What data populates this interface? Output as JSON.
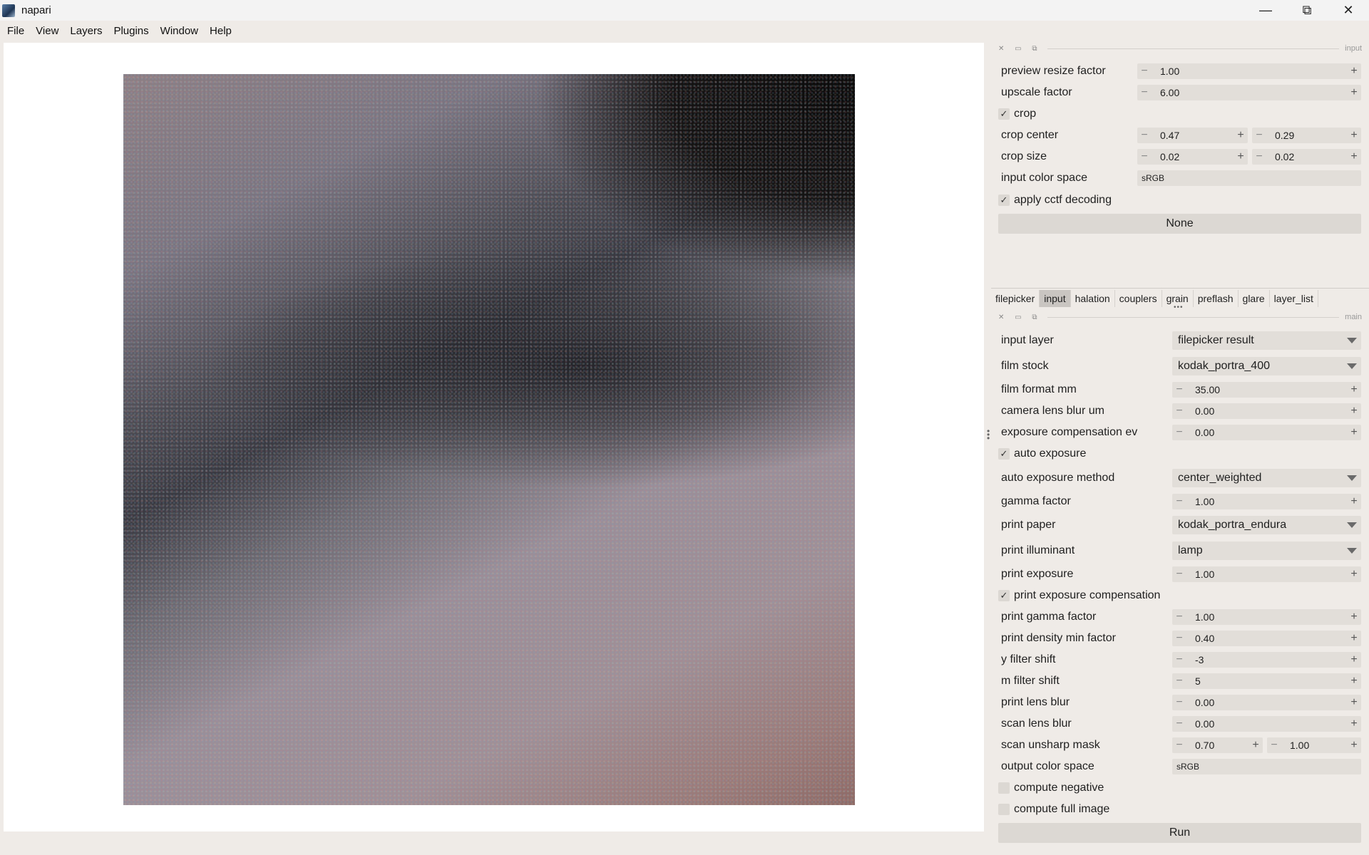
{
  "window": {
    "title": "napari",
    "min_icon": "minimize-icon",
    "max_icon": "restore-icon",
    "close_icon": "close-icon"
  },
  "menu": [
    "File",
    "View",
    "Layers",
    "Plugins",
    "Window",
    "Help"
  ],
  "input_panel": {
    "dock_name": "input",
    "preview_resize_factor": {
      "label": "preview resize factor",
      "value": "1.00"
    },
    "upscale_factor": {
      "label": "upscale factor",
      "value": "6.00"
    },
    "crop": {
      "label": "crop",
      "checked": true
    },
    "crop_center": {
      "label": "crop center",
      "x": "0.47",
      "y": "0.29"
    },
    "crop_size": {
      "label": "crop size",
      "x": "0.02",
      "y": "0.02"
    },
    "input_color_space": {
      "label": "input color space",
      "value": "sRGB"
    },
    "apply_cctf": {
      "label": "apply cctf decoding",
      "checked": true
    },
    "result_button": "None"
  },
  "tabs": [
    "filepicker",
    "input",
    "halation",
    "couplers",
    "grain",
    "preflash",
    "glare",
    "layer_list"
  ],
  "active_tab": "input",
  "main_panel": {
    "dock_name": "main",
    "input_layer": {
      "label": "input layer",
      "value": "filepicker result"
    },
    "film_stock": {
      "label": "film stock",
      "value": "kodak_portra_400"
    },
    "film_format_mm": {
      "label": "film format mm",
      "value": "35.00"
    },
    "camera_lens_blur": {
      "label": "camera lens blur um",
      "value": "0.00"
    },
    "exposure_comp": {
      "label": "exposure compensation ev",
      "value": "0.00"
    },
    "auto_exposure": {
      "label": "auto exposure",
      "checked": true
    },
    "auto_exposure_method": {
      "label": "auto exposure method",
      "value": "center_weighted"
    },
    "gamma_factor": {
      "label": "gamma factor",
      "value": "1.00"
    },
    "print_paper": {
      "label": "print paper",
      "value": "kodak_portra_endura"
    },
    "print_illuminant": {
      "label": "print illuminant",
      "value": "lamp"
    },
    "print_exposure": {
      "label": "print exposure",
      "value": "1.00"
    },
    "print_exposure_comp": {
      "label": "print exposure compensation",
      "checked": true
    },
    "print_gamma_factor": {
      "label": "print gamma factor",
      "value": "1.00"
    },
    "print_density_min": {
      "label": "print density min factor",
      "value": "0.40"
    },
    "y_filter_shift": {
      "label": "y filter shift",
      "value": "-3"
    },
    "m_filter_shift": {
      "label": "m filter shift",
      "value": "5"
    },
    "print_lens_blur": {
      "label": "print lens blur",
      "value": "0.00"
    },
    "scan_lens_blur": {
      "label": "scan lens blur",
      "value": "0.00"
    },
    "scan_unsharp_mask": {
      "label": "scan unsharp mask",
      "a": "0.70",
      "b": "1.00"
    },
    "output_color_space": {
      "label": "output color space",
      "value": "sRGB"
    },
    "compute_negative": {
      "label": "compute negative",
      "checked": false
    },
    "compute_full_image": {
      "label": "compute full image",
      "checked": false
    },
    "run_button": "Run"
  }
}
